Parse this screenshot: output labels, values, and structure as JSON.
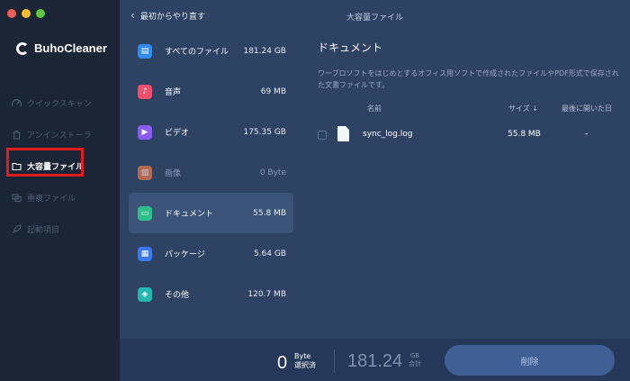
{
  "app": {
    "name": "BuhoCleaner"
  },
  "sidebar": {
    "items": [
      {
        "label": "クイックスキャン",
        "icon": "quick-scan-icon",
        "active": false
      },
      {
        "label": "アンインストーラ",
        "icon": "trash-icon",
        "active": false
      },
      {
        "label": "大容量ファイル",
        "icon": "folder-icon",
        "active": true
      },
      {
        "label": "重複ファイル",
        "icon": "duplicate-icon",
        "active": false
      },
      {
        "label": "起動項目",
        "icon": "rocket-icon",
        "active": false
      }
    ]
  },
  "header": {
    "back_label": "最初からやり直す",
    "title": "大容量ファイル"
  },
  "categories": [
    {
      "name": "すべてのファイル",
      "size": "181.24 GB",
      "icon": "all-files-icon",
      "color": "#2f8cf0"
    },
    {
      "name": "音声",
      "size": "69 MB",
      "icon": "audio-icon",
      "color": "#f0506e"
    },
    {
      "name": "ビデオ",
      "size": "175.35 GB",
      "icon": "video-icon",
      "color": "#8a5cf5"
    },
    {
      "name": "画像",
      "size": "0 Byte",
      "icon": "image-icon",
      "color": "#f07a4a"
    },
    {
      "name": "ドキュメント",
      "size": "55.8 MB",
      "icon": "document-icon",
      "color": "#2cc08a"
    },
    {
      "name": "パッケージ",
      "size": "5.64 GB",
      "icon": "package-icon",
      "color": "#3a78f0"
    },
    {
      "name": "その他",
      "size": "120.7 MB",
      "icon": "other-icon",
      "color": "#22b8b0"
    }
  ],
  "detail": {
    "title": "ドキュメント",
    "description": "ワープロソフトをはじめとするオフィス用ソフトで作成されたファイルやPDF形式で保存された文書ファイルです。",
    "columns": {
      "name": "名前",
      "size": "サイズ ↓",
      "last_opened": "最後に開いた日"
    },
    "files": [
      {
        "name": "sync_log.log",
        "size": "55.8 MB",
        "last_opened": "-"
      }
    ]
  },
  "footer": {
    "selected_count": "0",
    "selected_unit": "Byte",
    "selected_label": "選択済",
    "total": "181.24",
    "total_unit": "GB",
    "total_label": "合計",
    "delete_label": "削除"
  }
}
